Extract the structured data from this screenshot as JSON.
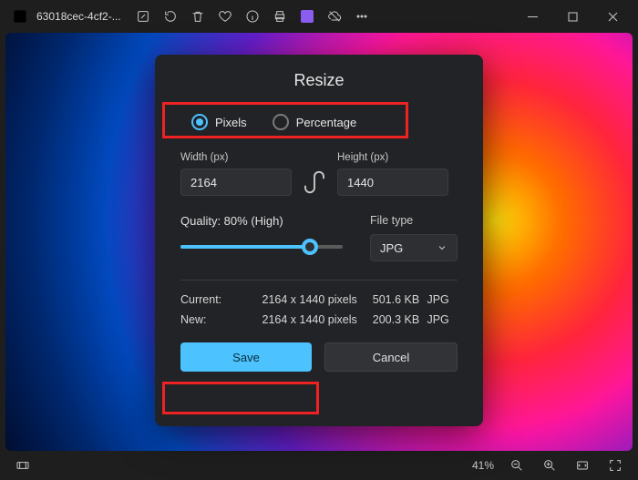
{
  "titlebar": {
    "filename": "63018cec-4cf2-..."
  },
  "dialog": {
    "title": "Resize",
    "units": {
      "pixels": "Pixels",
      "percentage": "Percentage",
      "selected": "pixels"
    },
    "width_label": "Width (px)",
    "height_label": "Height (px)",
    "width_value": "2164",
    "height_value": "1440",
    "quality_label": "Quality: 80% (High)",
    "quality_percent": 80,
    "filetype_label": "File type",
    "filetype_value": "JPG",
    "info": {
      "current_label": "Current:",
      "new_label": "New:",
      "current_dim": "2164 x 1440 pixels",
      "new_dim": "2164 x 1440 pixels",
      "current_size": "501.6 KB",
      "new_size": "200.3 KB",
      "current_fmt": "JPG",
      "new_fmt": "JPG"
    },
    "save_label": "Save",
    "cancel_label": "Cancel"
  },
  "statusbar": {
    "zoom": "41%"
  }
}
